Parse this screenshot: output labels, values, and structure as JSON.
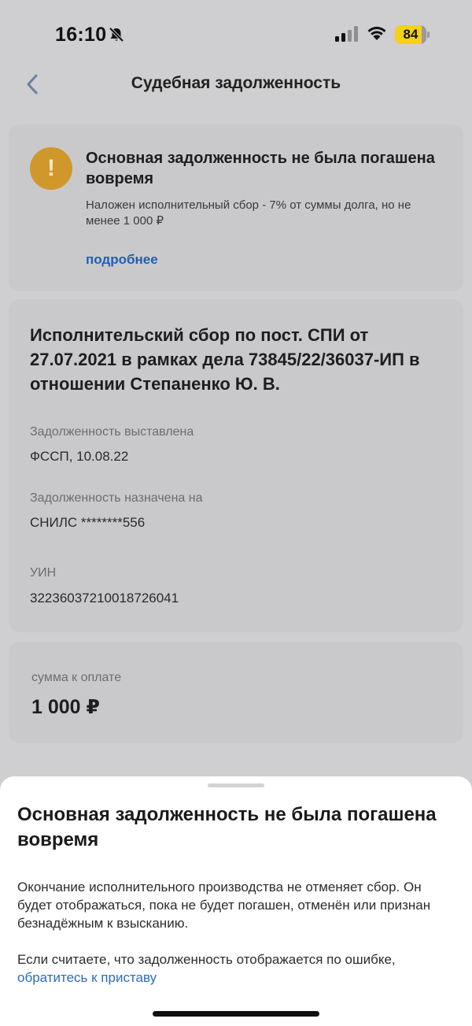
{
  "status_bar": {
    "time": "16:10",
    "battery_level": "84",
    "battery_fraction": 0.84,
    "icons": [
      "bell-muted-icon",
      "cellular-signal-icon",
      "wifi-icon",
      "battery-icon"
    ]
  },
  "header": {
    "title": "Судебная задолженность",
    "back_icon": "chevron-left-icon"
  },
  "alert": {
    "icon": "exclamation-icon",
    "color": "#d0972a",
    "title": "Основная задолженность не была погашена вовремя",
    "text": "Наложен исполнительный сбор - 7% от суммы долга, но не менее 1 000 ₽",
    "link": "подробнее"
  },
  "debt": {
    "title": "Исполнительский сбор по пост. СПИ от 27.07.2021 в рамках дела 73845/22/36037-ИП в отношении Степаненко Ю. В.",
    "fields": [
      {
        "label": "Задолженность выставлена",
        "value": "ФССП, 10.08.22"
      },
      {
        "label": "Задолженность назначена на",
        "value": "СНИЛС ********556"
      },
      {
        "label": "УИН",
        "value": "32236037210018726041"
      }
    ]
  },
  "payment": {
    "label": "сумма к оплате",
    "amount": "1 000 ₽"
  },
  "sheet": {
    "title": "Основная задолженность не была погашена вовремя",
    "text": "Окончание исполнительного производства не отменяет сбор. Он будет отображаться, пока не будет погашен, отменён или признан безнадёжным к взысканию.",
    "text2": "Если считаете, что задолженность отображается по ошибке,",
    "link": "обратитесь к приставу"
  },
  "colors": {
    "link": "#1f5fb4",
    "battery": "#f4d21a"
  }
}
